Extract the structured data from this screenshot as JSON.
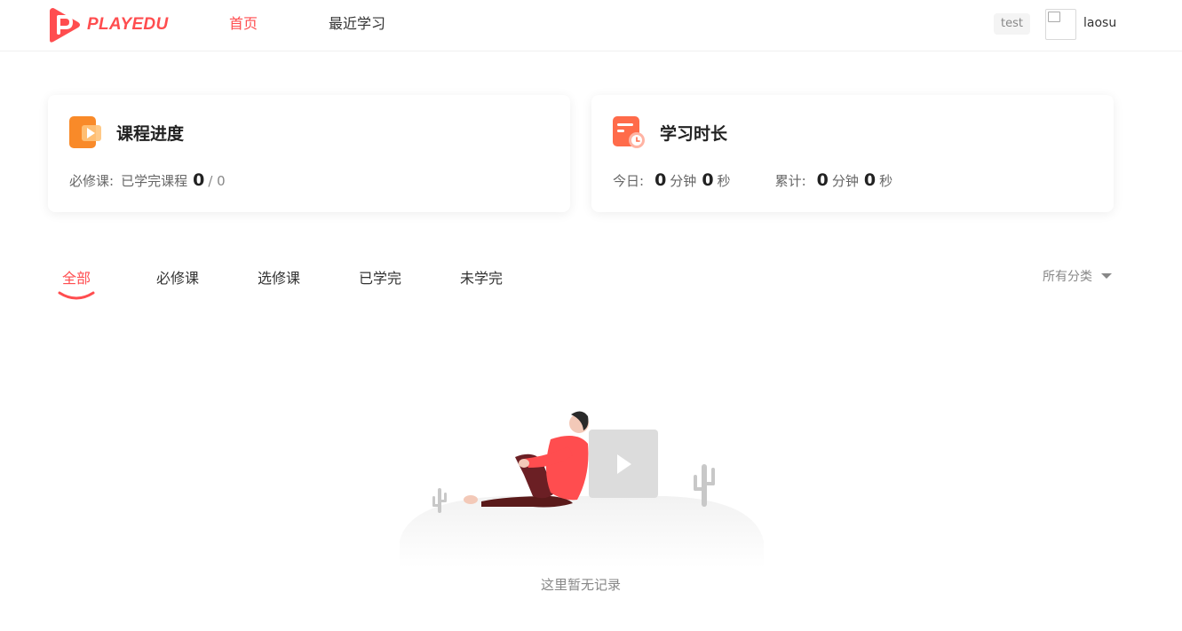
{
  "header": {
    "brand": "PLAYEDU",
    "nav": [
      {
        "label": "首页",
        "active": true
      },
      {
        "label": "最近学习",
        "active": false
      }
    ],
    "department": "test",
    "username": "laosu"
  },
  "stats": {
    "course_progress": {
      "title": "课程进度",
      "required_label": "必修课:",
      "completed_label": "已学完课程",
      "completed": "0",
      "total": "/ 0"
    },
    "study_time": {
      "title": "学习时长",
      "today_label": "今日:",
      "today_minutes": "0",
      "today_seconds": "0",
      "total_label": "累计:",
      "total_minutes": "0",
      "total_seconds": "0",
      "minute_unit": "分钟",
      "second_unit": "秒"
    }
  },
  "tabs": [
    {
      "label": "全部",
      "active": true
    },
    {
      "label": "必修课",
      "active": false
    },
    {
      "label": "选修课",
      "active": false
    },
    {
      "label": "已学完",
      "active": false
    },
    {
      "label": "未学完",
      "active": false
    }
  ],
  "category_filter": {
    "label": "所有分类"
  },
  "empty_state": {
    "text": "这里暂无记录"
  },
  "colors": {
    "accent": "#ff4d4f",
    "card_icon_orange": "#f98a29",
    "card_icon_red": "#ff6b4a"
  },
  "icons": {
    "logo": "playedu-logo",
    "progress": "video-play-icon",
    "time": "calendar-clock-icon",
    "filter": "caret-down-icon"
  }
}
